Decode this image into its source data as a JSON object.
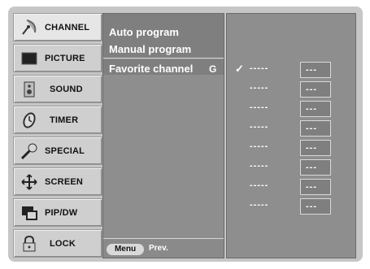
{
  "sidebar": {
    "items": [
      {
        "label": "CHANNEL",
        "icon": "satellite-dish-icon",
        "active": true
      },
      {
        "label": "PICTURE",
        "icon": "tv-screen-icon"
      },
      {
        "label": "SOUND",
        "icon": "speaker-icon"
      },
      {
        "label": "TIMER",
        "icon": "clock-icon"
      },
      {
        "label": "SPECIAL",
        "icon": "wrench-icon"
      },
      {
        "label": "SCREEN",
        "icon": "screen-adjust-icon"
      },
      {
        "label": "PIP/DW",
        "icon": "pip-window-icon"
      },
      {
        "label": "LOCK",
        "icon": "padlock-icon"
      }
    ]
  },
  "menu": {
    "items": [
      {
        "label": "Auto program"
      },
      {
        "label": "Manual program"
      },
      {
        "label": "Favorite channel",
        "key": "G",
        "selected": true
      }
    ],
    "footer": {
      "button_label": "Menu",
      "hint": "Prev."
    }
  },
  "favorites": {
    "rows": [
      {
        "check": "✓",
        "name": "-----",
        "number": "---"
      },
      {
        "check": "",
        "name": "-----",
        "number": "---"
      },
      {
        "check": "",
        "name": "-----",
        "number": "---"
      },
      {
        "check": "",
        "name": "-----",
        "number": "---"
      },
      {
        "check": "",
        "name": "-----",
        "number": "---"
      },
      {
        "check": "",
        "name": "-----",
        "number": "---"
      },
      {
        "check": "",
        "name": "-----",
        "number": "---"
      },
      {
        "check": "",
        "name": "-----",
        "number": "---"
      }
    ]
  },
  "colors": {
    "frame": "#c6c6c6",
    "panel": "#8e8e8e",
    "menu_text": "#ffffff"
  }
}
